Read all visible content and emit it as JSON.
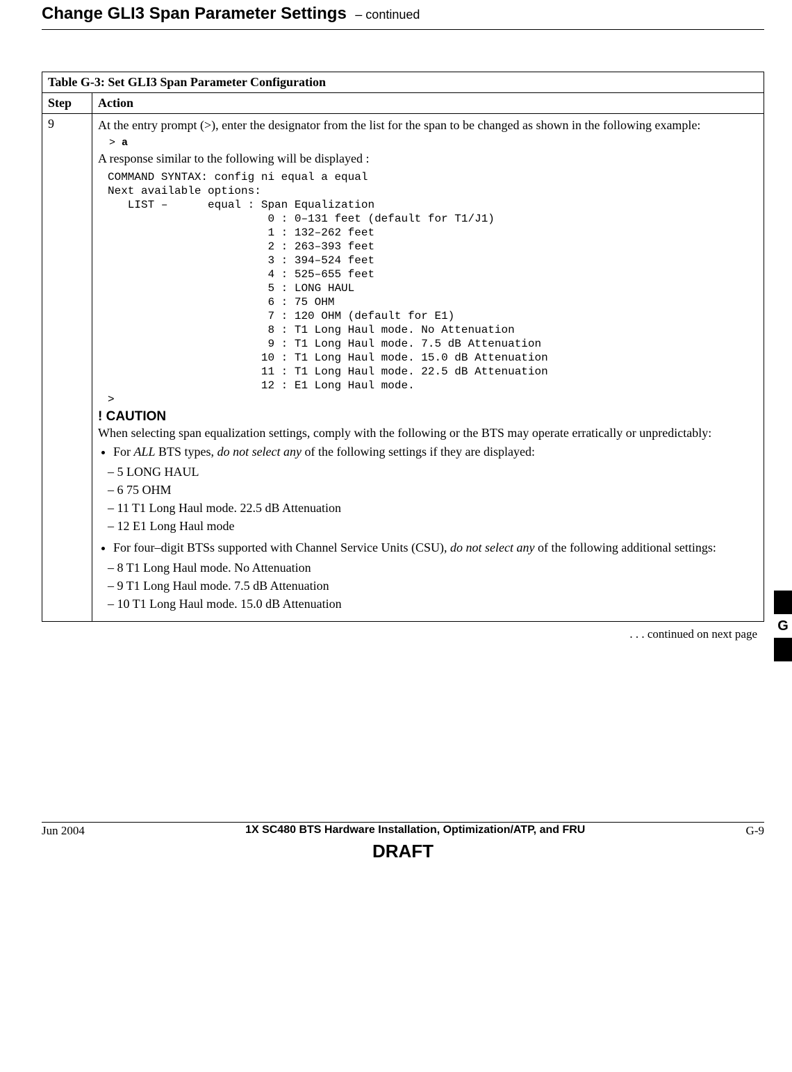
{
  "header": {
    "title": "Change GLI3 Span Parameter Settings",
    "continued": "– continued"
  },
  "table": {
    "caption_prefix": "Table G-3:",
    "caption_rest": " Set GLI3 Span Parameter Configuration",
    "col_step": "Step",
    "col_action": "Action",
    "step": "9",
    "intro": "At the entry prompt (>), enter the designator from the list for the span to be changed as shown in the following example:",
    "prompt_gt": "> ",
    "prompt_input": "a",
    "response_intro": "A response similar to the following will be displayed :",
    "code": "COMMAND SYNTAX: config ni equal a equal\nNext available options:\n   LIST –      equal : Span Equalization\n                        0 : 0–131 feet (default for T1/J1)\n                        1 : 132–262 feet\n                        2 : 263–393 feet\n                        3 : 394–524 feet\n                        4 : 525–655 feet\n                        5 : LONG HAUL\n                        6 : 75 OHM\n                        7 : 120 OHM (default for E1)\n                        8 : T1 Long Haul mode. No Attenuation\n                        9 : T1 Long Haul mode. 7.5 dB Attenuation\n                       10 : T1 Long Haul mode. 15.0 dB Attenuation\n                       11 : T1 Long Haul mode. 22.5 dB Attenuation\n                       12 : E1 Long Haul mode.\n>",
    "caution_head": "! CAUTION",
    "caution_text": "When selecting span equalization settings, comply with the following or the BTS may operate erratically or unpredictably:",
    "bullet1_pre": "For ",
    "bullet1_allbts": "ALL",
    "bullet1_mid": " BTS types, ",
    "bullet1_donot": "do not select any",
    "bullet1_post": " of the following settings if they are displayed:",
    "dash_a": [
      "5   LONG HAUL",
      "6   75 OHM",
      "11  T1 Long Haul mode.  22.5 dB Attenuation",
      "12  E1 Long Haul mode"
    ],
    "bullet2_pre": "For four–digit BTSs supported with Channel Service Units (CSU), ",
    "bullet2_donot": "do not select any",
    "bullet2_post": " of the following additional settings:",
    "dash_b": [
      "8   T1 Long Haul mode.  No Attenuation",
      "9   T1 Long Haul mode.  7.5 dB Attenuation",
      "10  T1 Long Haul mode.  15.0 dB Attenuation"
    ]
  },
  "continued_note": ". . . continued on next page",
  "footer": {
    "date": "Jun 2004",
    "title": "1X SC480 BTS Hardware Installation, Optimization/ATP, and FRU",
    "page": "G-9",
    "draft": "DRAFT"
  },
  "side_tab": "G"
}
